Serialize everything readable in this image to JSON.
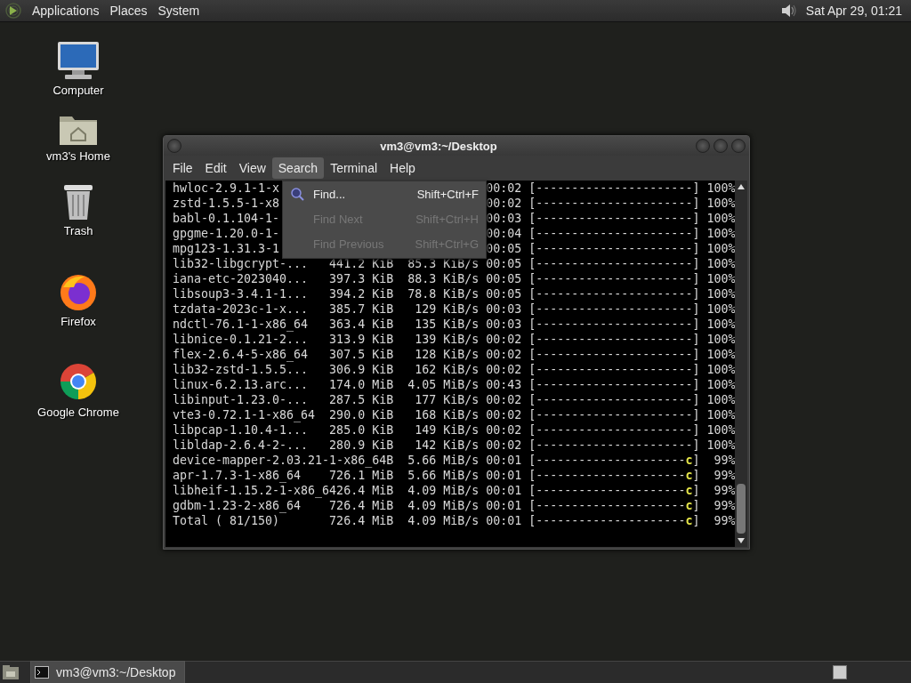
{
  "top_panel": {
    "menus": [
      "Applications",
      "Places",
      "System"
    ],
    "clock": "Sat Apr 29, 01:21"
  },
  "desktop_icons": [
    {
      "label": "Computer",
      "kind": "computer"
    },
    {
      "label": "vm3's Home",
      "kind": "home"
    },
    {
      "label": "Trash",
      "kind": "trash"
    },
    {
      "label": "Firefox",
      "kind": "firefox"
    },
    {
      "label": "Google Chrome",
      "kind": "chrome"
    }
  ],
  "window": {
    "title": "vm3@vm3:~/Desktop",
    "menus": [
      {
        "label": "File",
        "selected": false
      },
      {
        "label": "Edit",
        "selected": false
      },
      {
        "label": "View",
        "selected": false
      },
      {
        "label": "Search",
        "selected": true
      },
      {
        "label": "Terminal",
        "selected": false
      },
      {
        "label": "Help",
        "selected": false
      }
    ],
    "terminal_lines": [
      {
        "kind": "covered",
        "left": "hwloc-2.9.1-1-x",
        "right": "00:02 [----------------------] 100%"
      },
      {
        "kind": "covered",
        "left": "zstd-1.5.5-1-x8",
        "right": "00:02 [----------------------] 100%"
      },
      {
        "kind": "covered",
        "left": "babl-0.1.104-1-",
        "right": "00:03 [----------------------] 100%"
      },
      {
        "kind": "covered",
        "left": "gpgme-1.20.0-1-",
        "right": "00:04 [----------------------] 100%"
      },
      {
        "kind": "covered",
        "left": "mpg123-1.31.3-1",
        "right": "00:05 [----------------------] 100%"
      },
      {
        "kind": "full",
        "text": "lib32-libgcrypt-...   441.2 KiB  85.3 KiB/s 00:05 [----------------------] 100%"
      },
      {
        "kind": "full",
        "text": "iana-etc-2023040...   397.3 KiB  88.3 KiB/s 00:05 [----------------------] 100%"
      },
      {
        "kind": "full",
        "text": "libsoup3-3.4.1-1...   394.2 KiB  78.8 KiB/s 00:05 [----------------------] 100%"
      },
      {
        "kind": "full",
        "text": "tzdata-2023c-1-x...   385.7 KiB   129 KiB/s 00:03 [----------------------] 100%"
      },
      {
        "kind": "full",
        "text": "ndctl-76.1-1-x86_64   363.4 KiB   135 KiB/s 00:03 [----------------------] 100%"
      },
      {
        "kind": "full",
        "text": "libnice-0.1.21-2...   313.9 KiB   139 KiB/s 00:02 [----------------------] 100%"
      },
      {
        "kind": "full",
        "text": "flex-2.6.4-5-x86_64   307.5 KiB   128 KiB/s 00:02 [----------------------] 100%"
      },
      {
        "kind": "full",
        "text": "lib32-zstd-1.5.5...   306.9 KiB   162 KiB/s 00:02 [----------------------] 100%"
      },
      {
        "kind": "full",
        "text": "linux-6.2.13.arc...   174.0 MiB  4.05 MiB/s 00:43 [----------------------] 100%"
      },
      {
        "kind": "full",
        "text": "libinput-1.23.0-...   287.5 KiB   177 KiB/s 00:02 [----------------------] 100%"
      },
      {
        "kind": "full",
        "text": "vte3-0.72.1-1-x86_64  290.0 KiB   168 KiB/s 00:02 [----------------------] 100%"
      },
      {
        "kind": "full",
        "text": "libpcap-1.10.4-1...   285.0 KiB   149 KiB/s 00:02 [----------------------] 100%"
      },
      {
        "kind": "full",
        "text": "libldap-2.6.4-2-...   280.9 KiB   142 KiB/s 00:02 [----------------------] 100%"
      },
      {
        "kind": "full",
        "text": "device-mapper-2.03.21-1-x86_64B  5.66 MiB/s 00:01 [---------------------",
        "pacman": "c",
        "tail": "]  99%"
      },
      {
        "kind": "full",
        "text": "apr-1.7.3-1-x86_64    726.1 MiB  5.66 MiB/s 00:01 [---------------------",
        "pacman": "c",
        "tail": "]  99%"
      },
      {
        "kind": "full",
        "text": "libheif-1.15.2-1-x86_6426.4 MiB  4.09 MiB/s 00:01 [---------------------",
        "pacman": "c",
        "tail": "]  99%"
      },
      {
        "kind": "full",
        "text": "gdbm-1.23-2-x86_64    726.4 MiB  4.09 MiB/s 00:01 [---------------------",
        "pacman": "c",
        "tail": "]  99%"
      },
      {
        "kind": "full",
        "text": "Total ( 81/150)       726.4 MiB  4.09 MiB/s 00:01 [---------------------",
        "pacman": "c",
        "tail": "]  99%"
      }
    ],
    "search_menu": [
      {
        "label": "Find...",
        "shortcut": "Shift+Ctrl+F",
        "disabled": false,
        "kind": "find"
      },
      {
        "label": "Find Next",
        "shortcut": "Shift+Ctrl+H",
        "disabled": true,
        "kind": "plain"
      },
      {
        "label": "Find Previous",
        "shortcut": "Shift+Ctrl+G",
        "disabled": true,
        "kind": "plain"
      }
    ]
  },
  "taskbar": {
    "tasks": [
      {
        "label": "vm3@vm3:~/Desktop",
        "selected": true
      }
    ]
  }
}
